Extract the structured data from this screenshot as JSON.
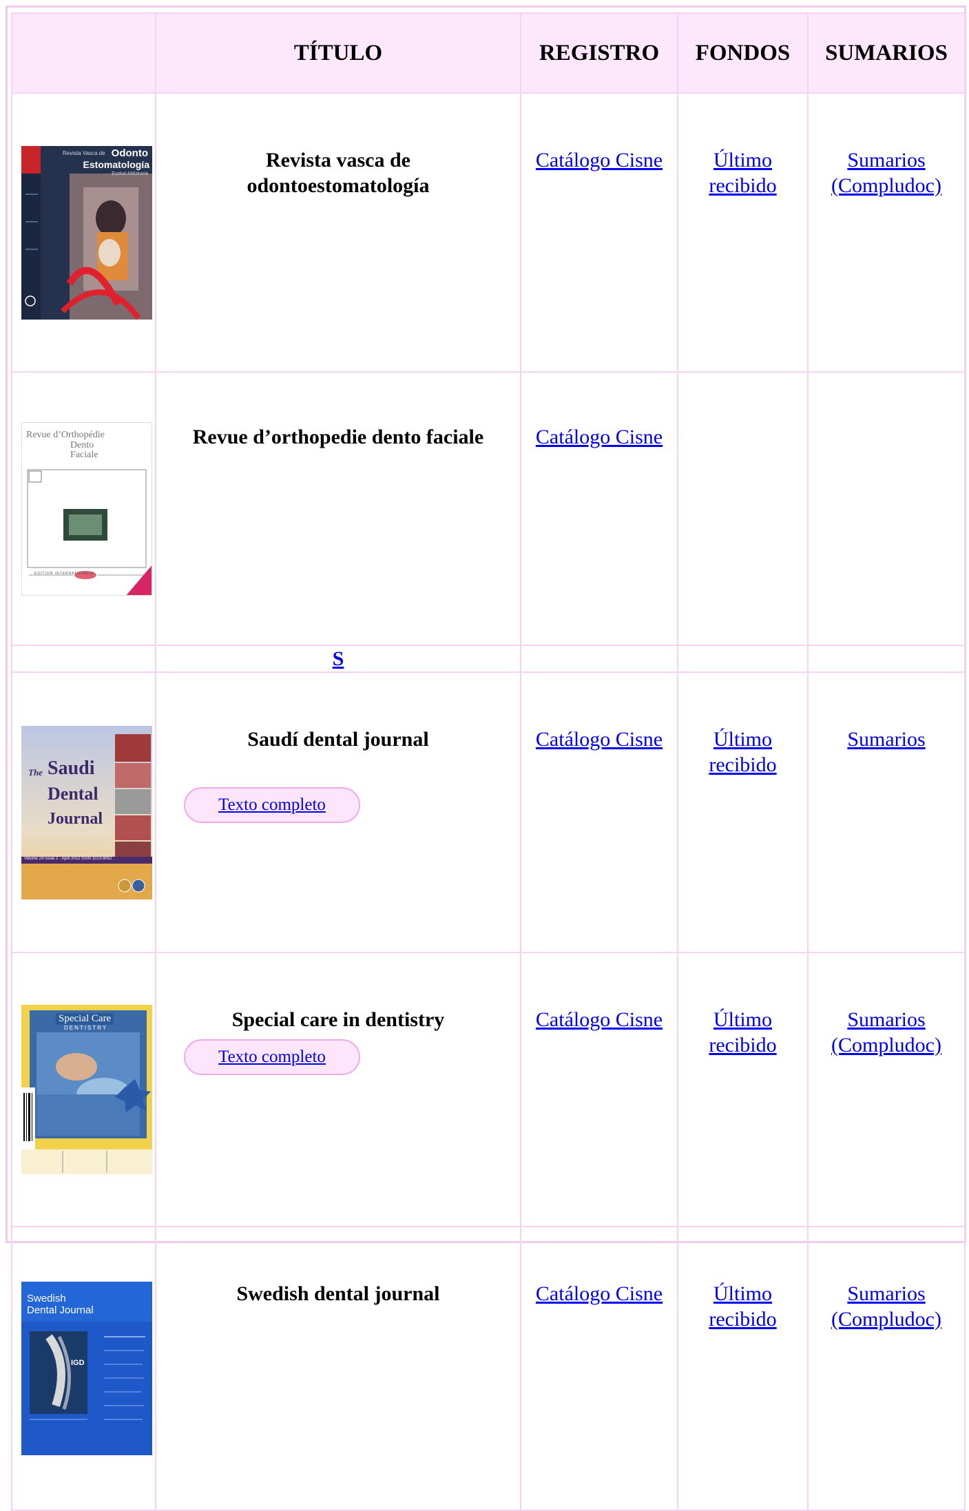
{
  "header": {
    "titulo": "TÍTULO",
    "registro": "REGISTRO",
    "fondos": "FONDOS",
    "sumarios": "SUMARIOS"
  },
  "rows": [
    {
      "title_line1": "Revista vasca de",
      "title_line2": "odontoestomatología",
      "registro": "Catálogo Cisne",
      "fondos_line1": "Último",
      "fondos_line2": "recibido",
      "sumarios_line1": "Sumarios",
      "sumarios_line2": "(Compludoc)",
      "cover": {
        "line1": "Odonto",
        "line2": "Estomatología",
        "small": "Revista Vasca de",
        "sub": "Euskal Aldizkaria",
        "colors": {
          "bg": "#2a3b5c",
          "accent": "#e02020"
        }
      }
    },
    {
      "title": "Revue d’orthopedie dento faciale",
      "registro": "Catálogo Cisne",
      "cover": {
        "line1": "Revue d’Orthopédie",
        "line2": "Dento",
        "line3": "Faciale",
        "footer": "ÉDITION  INTERNATIONALE"
      }
    },
    {
      "letter": "S"
    },
    {
      "title": "Saudí dental journal",
      "button": "Texto completo",
      "registro": "Catálogo Cisne",
      "fondos_line1": "Último",
      "fondos_line2": "recibido",
      "sumarios": "Sumarios",
      "cover": {
        "word_the": "The",
        "word1": "Saudi",
        "word2": "Dental",
        "word3": "Journal",
        "issue": "Volume 24 Issue 2 · April 2012   ISSN 1013-9052"
      }
    },
    {
      "title": "Special care in dentistry",
      "button": "Texto completo",
      "registro": "Catálogo Cisne",
      "fondos_line1": "Último",
      "fondos_line2": "recibido",
      "sumarios_line1": "Sumarios",
      "sumarios_line2": "(Compludoc)",
      "cover": {
        "line1": "Special Care",
        "line2": "DENTISTRY"
      }
    },
    {
      "title": "Swedish dental journal",
      "registro": "Catálogo Cisne",
      "fondos_line1": "Último",
      "fondos_line2": "recibido",
      "sumarios_line1": "Sumarios",
      "sumarios_line2": "(Compludoc)",
      "cover": {
        "line1": "Swedish",
        "line2": "Dental Journal",
        "badge": "IGD"
      }
    }
  ],
  "colors": {
    "border": "#f7d2f3",
    "header_bg": "#fde8fb",
    "link": "#0000ee",
    "pill_bg": "#fde6fb",
    "pill_border": "#f2a8ea"
  }
}
